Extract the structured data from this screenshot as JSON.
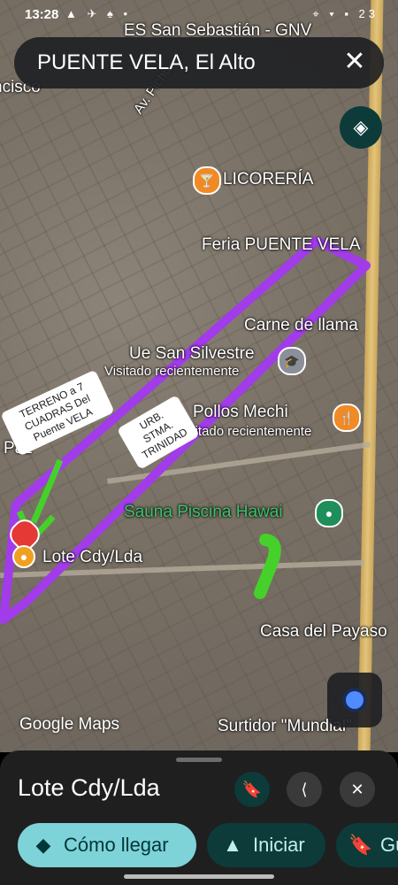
{
  "status": {
    "time": "13:28",
    "icons": "▲ ✈ ♠ •",
    "right": "⌖ ▾ ▪ 23"
  },
  "search": {
    "query": "PUENTE VELA, El Alto",
    "close_glyph": "✕"
  },
  "map": {
    "labels": {
      "gnv": "ES San Sebastián - GNV",
      "cisco": "ncisco",
      "pichu": "Av. Pichu",
      "licoreria": "LICORERÍA",
      "feria": "Feria PUENTE VELA",
      "carne": "Carne de llama",
      "ue": "Ue San Silvestre",
      "visitado1": "Visitado recientemente",
      "pollos": "Pollos Mechi",
      "visitado2": "Visitado recientemente",
      "paz": "Paz",
      "sauna": "Sauna Piscina Hawai",
      "lote": "Lote Cdy/Lda",
      "payaso": "Casa del Payaso",
      "surtidor": "Surtidor \"Mundial\""
    },
    "notes": {
      "terreno": "TERRENO a 7 CUADRAS Del Puente VELA",
      "urb": "URB. STMA. TRINIDAD"
    },
    "pin_icons": {
      "licoreria": "🍸",
      "pollos": "🍴",
      "sauna": "●",
      "ue": "🎓",
      "lote": "●"
    },
    "watermark": "Google Maps",
    "colors": {
      "annotation_purple": "#a23bea",
      "annotation_green": "#45d12a",
      "pin_orange": "#f08a24",
      "pin_green": "#1e8e5a",
      "pin_red": "#e53935"
    }
  },
  "sheet": {
    "title": "Lote Cdy/Lda",
    "save_icon": "🔖",
    "share_icon": "⟨",
    "close_icon": "✕",
    "actions": [
      {
        "label": "Cómo llegar",
        "icon": "◆"
      },
      {
        "label": "Iniciar",
        "icon": "▲"
      },
      {
        "label": "Gu",
        "icon": "🔖"
      }
    ]
  }
}
